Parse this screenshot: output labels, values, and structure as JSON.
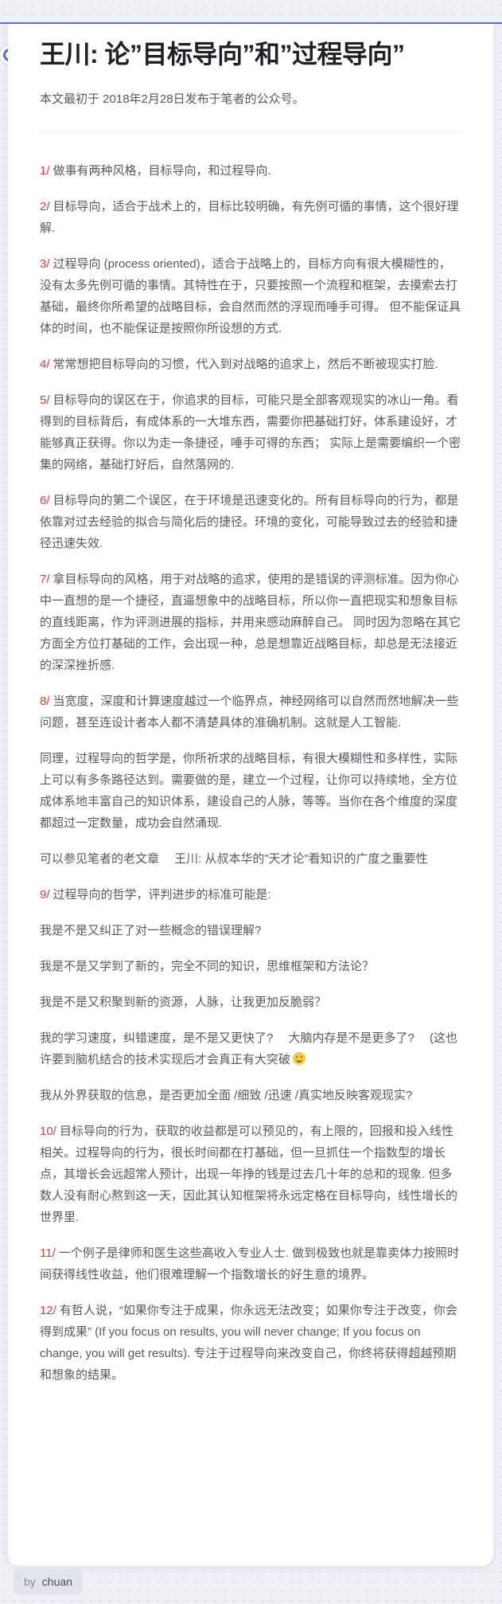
{
  "post": {
    "title": "王川: 论”目标导向”和”过程导向”",
    "subtitle": "本文最初于 2018年2月28日发布于笔者的公众号。",
    "paragraphs": [
      {
        "num": "1/",
        "text": "做事有两种风格，目标导向，和过程导向."
      },
      {
        "num": "2/",
        "text": "目标导向，适合于战术上的，目标比较明确，有先例可循的事情，这个很好理解."
      },
      {
        "num": "3/",
        "text": "过程导向 (process oriented)，适合于战略上的，目标方向有很大模糊性的，没有太多先例可循的事情。其特性在于，只要按照一个流程和框架，去摸索去打基础，最终你所希望的战略目标，会自然而然的浮现而唾手可得。 但不能保证具体的时间，也不能保证是按照你所设想的方式."
      },
      {
        "num": "4/",
        "text": "常常想把目标导向的习惯，代入到对战略的追求上，然后不断被现实打脸."
      },
      {
        "num": "5/",
        "text": "目标导向的误区在于，你追求的目标，可能只是全部客观现实的冰山一角。看得到的目标背后，有成体系的一大堆东西，需要你把基础打好，体系建设好，才能够真正获得。你以为走一条捷径，唾手可得的东西； 实际上是需要编织一个密集的网络，基础打好后，自然落网的."
      },
      {
        "num": "6/",
        "text": "目标导向的第二个误区，在于环境是迅速变化的。所有目标导向的行为，都是依靠对过去经验的拟合与简化后的捷径。环境的变化，可能导致过去的经验和捷径迅速失效."
      },
      {
        "num": "7/",
        "text": "拿目标导向的风格，用于对战略的追求，使用的是错误的评测标准。因为你心中一直想的是一个捷径，直逼想象中的战略目标，所以你一直把现实和想象目标的直线距离，作为评测进展的指标，并用来感动麻醉自己。 同时因为忽略在其它方面全方位打基础的工作，会出现一种，总是想靠近战略目标，却总是无法接近的深深挫折感."
      },
      {
        "num": "8/",
        "text": "当宽度，深度和计算速度越过一个临界点，神经网络可以自然而然地解决一些问题，甚至连设计者本人都不清楚具体的准确机制。这就是人工智能."
      },
      {
        "num": "",
        "text": "同理，过程导向的哲学是，你所祈求的战略目标，有很大模糊性和多样性，实际上可以有多条路径达到。需要做的是，建立一个过程，让你可以持续地，全方位成体系地丰富自己的知识体系，建设自己的人脉，等等。当你在各个维度的深度都超过一定数量，成功会自然涌现."
      },
      {
        "num": "",
        "text": "可以参见笔者的老文章 　王川: 从叔本华的”天才论”看知识的广度之重要性"
      },
      {
        "num": "9/",
        "text": "过程导向的哲学，评判进步的标准可能是:"
      },
      {
        "num": "",
        "text": "我是不是又纠正了对一些概念的错误理解?"
      },
      {
        "num": "",
        "text": "我是不是又学到了新的，完全不同的知识，思维框架和方法论？"
      },
      {
        "num": "",
        "text": "我是不是又积聚到新的资源，人脉，让我更加反脆弱？"
      },
      {
        "num": "",
        "text": "我的学习速度，纠错速度，是不是又更快了? 　大脑内存是不是更多了? 　(这也许要到脑机结合的技术实现后才会真正有大突破",
        "emoji": "smile-emoji"
      },
      {
        "num": "",
        "text": "我从外界获取的信息，是否更加全面 /细致 /迅速 /真实地反映客观现实?"
      },
      {
        "num": "10/",
        "text": "目标导向的行为，获取的收益都是可以预见的，有上限的，回报和投入线性相关。过程导向的行为，很长时间都在打基础，但一旦抓住一个指数型的增长点，其增长会远超常人预计，出现一年挣的钱是过去几十年的总和的现象. 但多数人没有耐心熬到这一天，因此其认知框架将永远定格在目标导向，线性增长的世界里."
      },
      {
        "num": "11/",
        "text": "一个例子是律师和医生这些高收入专业人士. 做到极致也就是靠卖体力按照时间获得线性收益，他们很难理解一个指数增长的好生意的境界。"
      },
      {
        "num": "12/",
        "text": "有哲人说，“如果你专注于成果，你永远无法改变；如果你专注于改变，你会得到成果” (If you focus on results, you will never change; If you focus on change, you will get results). 专注于过程导向来改变自己，你终将获得超越预期和想象的结果。"
      }
    ]
  },
  "footer": {
    "by_label": "by",
    "author": "chuan"
  },
  "colors": {
    "accent": "#4f6fe6",
    "number": "#e03c3c",
    "title": "#1f2024",
    "body": "#57595f"
  }
}
